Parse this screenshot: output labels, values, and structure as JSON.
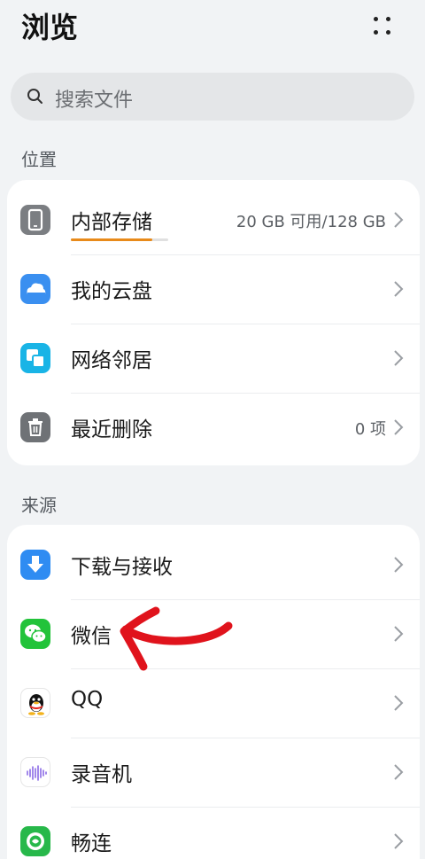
{
  "header": {
    "title": "浏览",
    "more_icon": "more-dots-icon"
  },
  "search": {
    "placeholder": "搜索文件",
    "icon": "search-icon"
  },
  "sections": {
    "location_label": "位置",
    "sources_label": "来源"
  },
  "location_items": [
    {
      "label": "内部存储",
      "value": "20 GB 可用/128 GB",
      "icon": "phone-storage-icon",
      "used_fraction": 0.84
    },
    {
      "label": "我的云盘",
      "value": "",
      "icon": "cloud-drive-icon"
    },
    {
      "label": "网络邻居",
      "value": "",
      "icon": "network-neighbor-icon"
    },
    {
      "label": "最近删除",
      "value": "0 项",
      "icon": "trash-icon"
    }
  ],
  "source_items": [
    {
      "label": "下载与接收",
      "icon": "download-icon"
    },
    {
      "label": "微信",
      "icon": "wechat-icon"
    },
    {
      "label": "QQ",
      "icon": "qq-icon"
    },
    {
      "label": "录音机",
      "icon": "recorder-icon"
    },
    {
      "label": "畅连",
      "icon": "changlian-icon"
    }
  ],
  "colors": {
    "background": "#f1f3f5",
    "card": "#ffffff",
    "progress": "#e88a1a",
    "annotation": "#e0131c",
    "wechat_green": "#22c33a",
    "cloud_blue": "#3a8ff0",
    "network_cyan": "#19b4e6",
    "download_blue": "#2f8cf2"
  }
}
